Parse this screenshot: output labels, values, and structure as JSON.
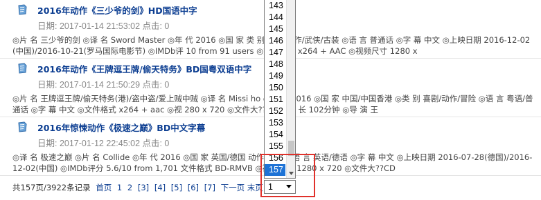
{
  "entries": [
    {
      "title": "2016年动作《三少爷的剑》HD国语中字",
      "meta": "日期: 2017-01-14 21:53:02 点击: 0",
      "description": "◎片 名 三少爷的剑 ◎译 名 Sword Master ◎年 代 2016 ◎国 家 类 别 剧情/动作/武侠/古装 ◎语 言 普通话 ◎字 幕 中文 ◎上映日期 2016-12-02(中国)/2016-10-21(罗马国际电影节) ◎IMDb评 10 from 91 users ◎文件格式 x264 + AAC ◎视频尺寸 1280 x"
    },
    {
      "title": "2016年动作《王牌逗王牌/偷天特务》BD国粤双语中字",
      "meta": "日期: 2017-01-14 21:50:29 点击: 0",
      "description": "◎片 名 王牌逗王牌/偷天特务(港)/盗中盗/爱上贼中贼 ◎译 名 Missi ho ◎年 代 2016 ◎国 家 中国/中国香港 ◎类 别 喜剧/动作/冒险 ◎语 言 粤语/普通话 ◎字 幕 中文 ◎文件格式 x264 + aac ◎视 280 x 720 ◎文件大??CD ◎片 长 102分钟 ◎导 演 王"
    },
    {
      "title": "2016年惊悚动作《极速之巅》BD中文字幕",
      "meta": "日期: 2017-01-12 22:45:02 点击: 0",
      "description": "◎译 名 极速之巅 ◎片 名 Collide ◎年 代 2016 ◎国 家 英国/德国 动作/惊悚 ◎语 言 英语/德语 ◎字 幕 中文 ◎上映日期 2016-07-28(德国)/2016-12-02(中国) ◎IMDb评分 5.6/10 from 1,701 文件格式 BD-RMVB ◎视频尺寸 1280 x 720 ◎文件大??CD"
    }
  ],
  "pager": {
    "summary": "共157页/3922条记录",
    "first": "首页",
    "pages": [
      "1",
      "2",
      "[3]",
      "[4]",
      "[5]",
      "[6]",
      "[7]"
    ],
    "next": "下一页",
    "last": "末页"
  },
  "page_select": {
    "options": [
      "143",
      "144",
      "145",
      "146",
      "147",
      "148",
      "149",
      "150",
      "151",
      "152",
      "153",
      "154",
      "155",
      "156",
      "157"
    ],
    "highlighted": "157",
    "value": "1"
  },
  "colors": {
    "title_link": "#0b3d91",
    "selection": "#1e73d6",
    "highlight_box": "#e0312b"
  }
}
